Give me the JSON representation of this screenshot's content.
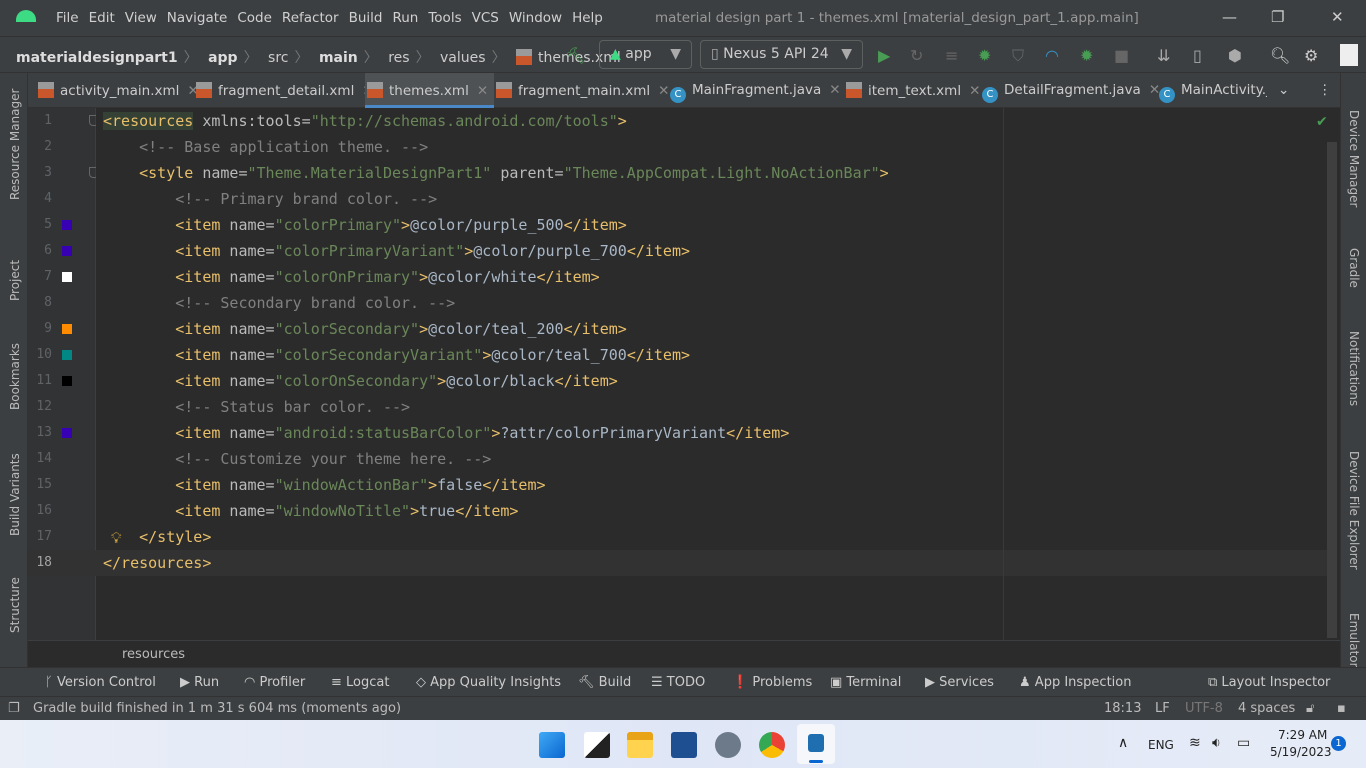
{
  "window": {
    "title": "material design part 1 - themes.xml [material_design_part_1.app.main]",
    "menu": [
      "File",
      "Edit",
      "View",
      "Navigate",
      "Code",
      "Refactor",
      "Build",
      "Run",
      "Tools",
      "VCS",
      "Window",
      "Help"
    ]
  },
  "navbar": {
    "breadcrumb": [
      "materialdesignpart1",
      "app",
      "src",
      "main",
      "res",
      "values",
      "themes.xml"
    ],
    "run_config": "app",
    "device": "Nexus 5 API 24"
  },
  "tabs": [
    {
      "label": "activity_main.xml",
      "type": "xml"
    },
    {
      "label": "fragment_detail.xml",
      "type": "xml"
    },
    {
      "label": "themes.xml",
      "type": "xml",
      "active": true
    },
    {
      "label": "fragment_main.xml",
      "type": "xml"
    },
    {
      "label": "MainFragment.java",
      "type": "class"
    },
    {
      "label": "item_text.xml",
      "type": "xml"
    },
    {
      "label": "DetailFragment.java",
      "type": "class"
    },
    {
      "label": "MainActivity.java",
      "type": "class"
    }
  ],
  "left_tools": [
    "Resource Manager",
    "Project",
    "Bookmarks",
    "Build Variants",
    "Structure"
  ],
  "right_tools": [
    "Device Manager",
    "Gradle",
    "Notifications",
    "Device File Explorer",
    "Emulator"
  ],
  "editor": {
    "swatches": {
      "5": "#3700b3",
      "6": "#3700b3",
      "7": "#ffffff",
      "9": "#ff8c00",
      "10": "#018786",
      "11": "#000000",
      "13": "#3700b3"
    },
    "current_line": 18,
    "lines": [
      [
        [
          "tag",
          "<resources"
        ],
        [
          "attr",
          " xmlns:tools="
        ],
        [
          "val",
          "\"http://schemas.android.com/tools\""
        ],
        [
          "tag",
          ">"
        ]
      ],
      [
        [
          "cm",
          "    <!-- Base application theme. -->"
        ]
      ],
      [
        [
          "tag",
          "    <style"
        ],
        [
          "attr",
          " name="
        ],
        [
          "val",
          "\"Theme.MaterialDesignPart1\""
        ],
        [
          "attr",
          " parent="
        ],
        [
          "val",
          "\"Theme.AppCompat.Light.NoActionBar\""
        ],
        [
          "tag",
          ">"
        ]
      ],
      [
        [
          "cm",
          "        <!-- Primary brand color. -->"
        ]
      ],
      [
        [
          "tag",
          "        <item"
        ],
        [
          "attr",
          " name="
        ],
        [
          "val",
          "\"colorPrimary\""
        ],
        [
          "tag",
          ">"
        ],
        [
          "txt",
          "@color/purple_500"
        ],
        [
          "tag",
          "</item>"
        ]
      ],
      [
        [
          "tag",
          "        <item"
        ],
        [
          "attr",
          " name="
        ],
        [
          "val",
          "\"colorPrimaryVariant\""
        ],
        [
          "tag",
          ">"
        ],
        [
          "txt",
          "@color/purple_700"
        ],
        [
          "tag",
          "</item>"
        ]
      ],
      [
        [
          "tag",
          "        <item"
        ],
        [
          "attr",
          " name="
        ],
        [
          "val",
          "\"colorOnPrimary\""
        ],
        [
          "tag",
          ">"
        ],
        [
          "txt",
          "@color/white"
        ],
        [
          "tag",
          "</item>"
        ]
      ],
      [
        [
          "cm",
          "        <!-- Secondary brand color. -->"
        ]
      ],
      [
        [
          "tag",
          "        <item"
        ],
        [
          "attr",
          " name="
        ],
        [
          "val",
          "\"colorSecondary\""
        ],
        [
          "tag",
          ">"
        ],
        [
          "txt",
          "@color/teal_200"
        ],
        [
          "tag",
          "</item>"
        ]
      ],
      [
        [
          "tag",
          "        <item"
        ],
        [
          "attr",
          " name="
        ],
        [
          "val",
          "\"colorSecondaryVariant\""
        ],
        [
          "tag",
          ">"
        ],
        [
          "txt",
          "@color/teal_700"
        ],
        [
          "tag",
          "</item>"
        ]
      ],
      [
        [
          "tag",
          "        <item"
        ],
        [
          "attr",
          " name="
        ],
        [
          "val",
          "\"colorOnSecondary\""
        ],
        [
          "tag",
          ">"
        ],
        [
          "txt",
          "@color/black"
        ],
        [
          "tag",
          "</item>"
        ]
      ],
      [
        [
          "cm",
          "        <!-- Status bar color. -->"
        ]
      ],
      [
        [
          "tag",
          "        <item"
        ],
        [
          "attr",
          " name="
        ],
        [
          "val",
          "\"android:statusBarColor\""
        ],
        [
          "tag",
          ">"
        ],
        [
          "txt",
          "?attr/colorPrimaryVariant"
        ],
        [
          "tag",
          "</item>"
        ]
      ],
      [
        [
          "cm",
          "        <!-- Customize your theme here. -->"
        ]
      ],
      [
        [
          "tag",
          "        <item"
        ],
        [
          "attr",
          " name="
        ],
        [
          "val",
          "\"windowActionBar\""
        ],
        [
          "tag",
          ">"
        ],
        [
          "txt",
          "false"
        ],
        [
          "tag",
          "</item>"
        ]
      ],
      [
        [
          "tag",
          "        <item"
        ],
        [
          "attr",
          " name="
        ],
        [
          "val",
          "\"windowNoTitle\""
        ],
        [
          "tag",
          ">"
        ],
        [
          "txt",
          "true"
        ],
        [
          "tag",
          "</item>"
        ]
      ],
      [
        [
          "tag",
          "    </style>"
        ]
      ],
      [
        [
          "tag",
          "</resources>"
        ]
      ]
    ]
  },
  "editor_breadcrumb": "resources",
  "tool_windows": [
    "Version Control",
    "Run",
    "Profiler",
    "Logcat",
    "App Quality Insights",
    "Build",
    "TODO",
    "Problems",
    "Terminal",
    "Services",
    "App Inspection",
    "Layout Inspector"
  ],
  "status": {
    "message": "Gradle build finished in 1 m 31 s 604 ms (moments ago)",
    "position": "18:13",
    "line_ending": "LF",
    "encoding": "UTF-8",
    "indent": "4 spaces"
  },
  "taskbar": {
    "language": "ENG",
    "time": "7:29 AM",
    "date": "5/19/2023",
    "notifications": "1"
  }
}
